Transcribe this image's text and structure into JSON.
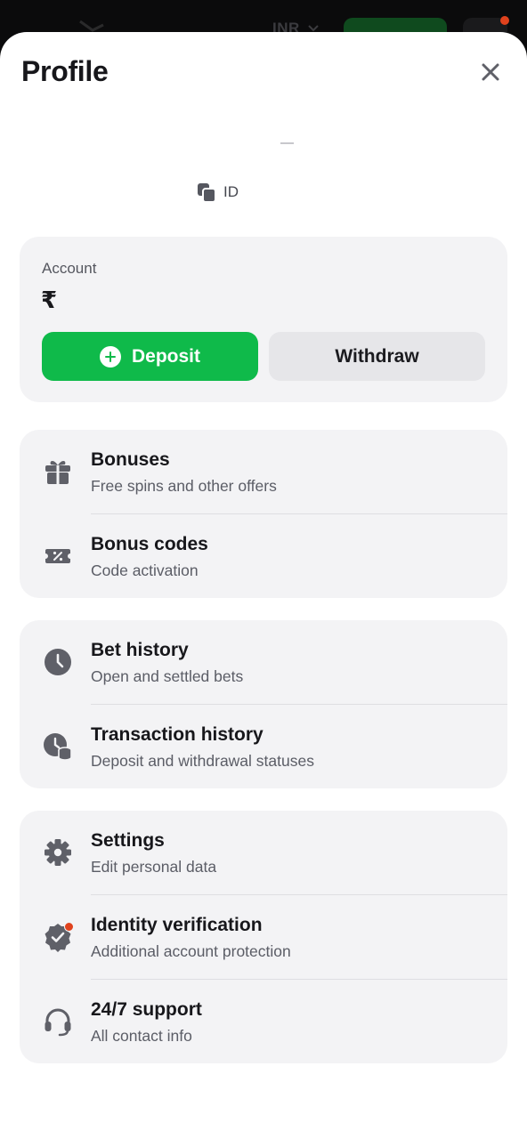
{
  "topbar": {
    "currency": "INR"
  },
  "header": {
    "title": "Profile"
  },
  "profile": {
    "id_label": "ID"
  },
  "account": {
    "label": "Account",
    "currency_symbol": "₹",
    "deposit_label": "Deposit",
    "withdraw_label": "Withdraw"
  },
  "groups": [
    {
      "items": [
        {
          "title": "Bonuses",
          "subtitle": "Free spins and other offers",
          "icon": "gift-icon"
        },
        {
          "title": "Bonus codes",
          "subtitle": "Code activation",
          "icon": "ticket-percent-icon"
        }
      ]
    },
    {
      "items": [
        {
          "title": "Bet history",
          "subtitle": "Open and settled bets",
          "icon": "clock-icon"
        },
        {
          "title": "Transaction history",
          "subtitle": "Deposit and withdrawal statuses",
          "icon": "clock-coins-icon"
        }
      ]
    },
    {
      "items": [
        {
          "title": "Settings",
          "subtitle": "Edit personal data",
          "icon": "gear-icon"
        },
        {
          "title": "Identity verification",
          "subtitle": "Additional account protection",
          "icon": "verified-badge-icon"
        },
        {
          "title": "24/7 support",
          "subtitle": "All contact info",
          "icon": "headset-icon"
        }
      ]
    }
  ],
  "colors": {
    "accent_green": "#0fba4a",
    "notification_dot": "#e0421d",
    "card_bg": "#f3f3f5",
    "icon_gray": "#5f6068"
  }
}
